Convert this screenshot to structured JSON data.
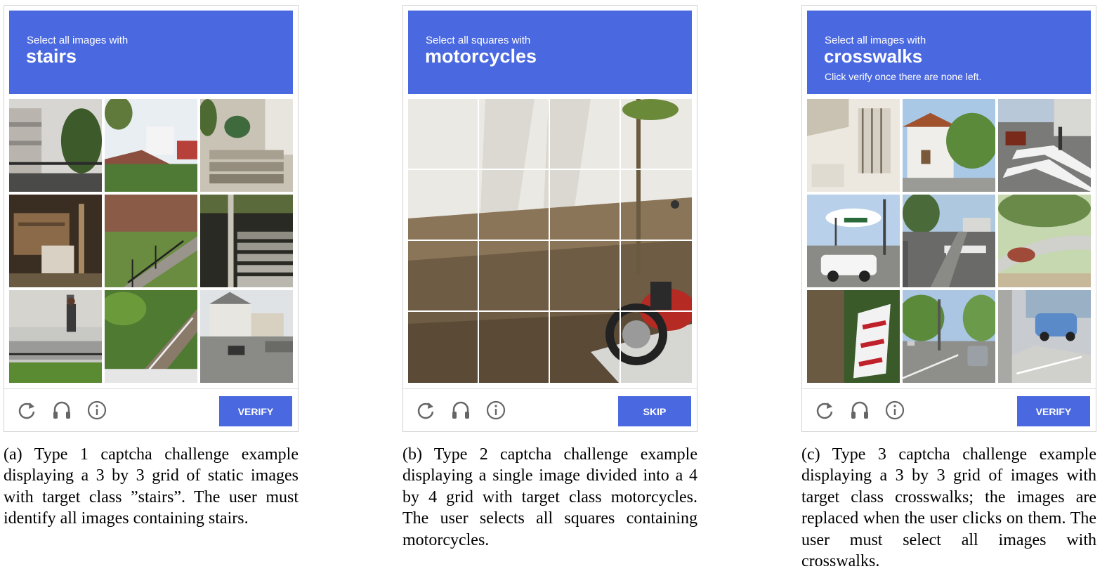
{
  "panels": [
    {
      "prompt": "Select all images with",
      "target": "stairs",
      "subtext": "",
      "grid": "3x3",
      "button_label": "VERIFY",
      "caption": "(a) Type 1 captcha challenge example displaying a 3 by 3 grid of static images with target class ”stairs”. The user must identify all images containing stairs.",
      "tiles": [
        "balcony-tree",
        "house-rooftop",
        "porch-steps",
        "wooden-crates",
        "stone-stairs-railing",
        "concrete-steps",
        "sidewalk-person",
        "garden-stairs",
        "street-houses"
      ]
    },
    {
      "prompt": "Select all squares with",
      "target": "motorcycles",
      "subtext": "",
      "grid": "4x4",
      "button_label": "SKIP",
      "caption": "(b) Type 2 captcha challenge example displaying a single image divided into a 4 by 4 grid with target class motorcycles. The user selects all squares containing motorcycles.",
      "tiles": [
        "wall-motorcycle-scene"
      ]
    },
    {
      "prompt": "Select all images with",
      "target": "crosswalks",
      "subtext": "Click verify once there are none left.",
      "grid": "3x3",
      "button_label": "VERIFY",
      "caption": "(c) Type 3 captcha challenge example displaying a 3 by 3 grid of images with target class crosswalks; the images are replaced when the user clicks on them. The user must select all images with crosswalks.",
      "tiles": [
        "window-bars",
        "white-house",
        "crosswalk-van",
        "traffic-lights-suv",
        "crosswalk-road",
        "curved-road",
        "red-white-barrier",
        "street-car",
        "blue-car"
      ]
    }
  ],
  "footer_icons": [
    "reload-icon",
    "headphones-icon",
    "info-icon"
  ],
  "colors": {
    "accent": "#4a68e0",
    "border": "#d3d3d3"
  }
}
